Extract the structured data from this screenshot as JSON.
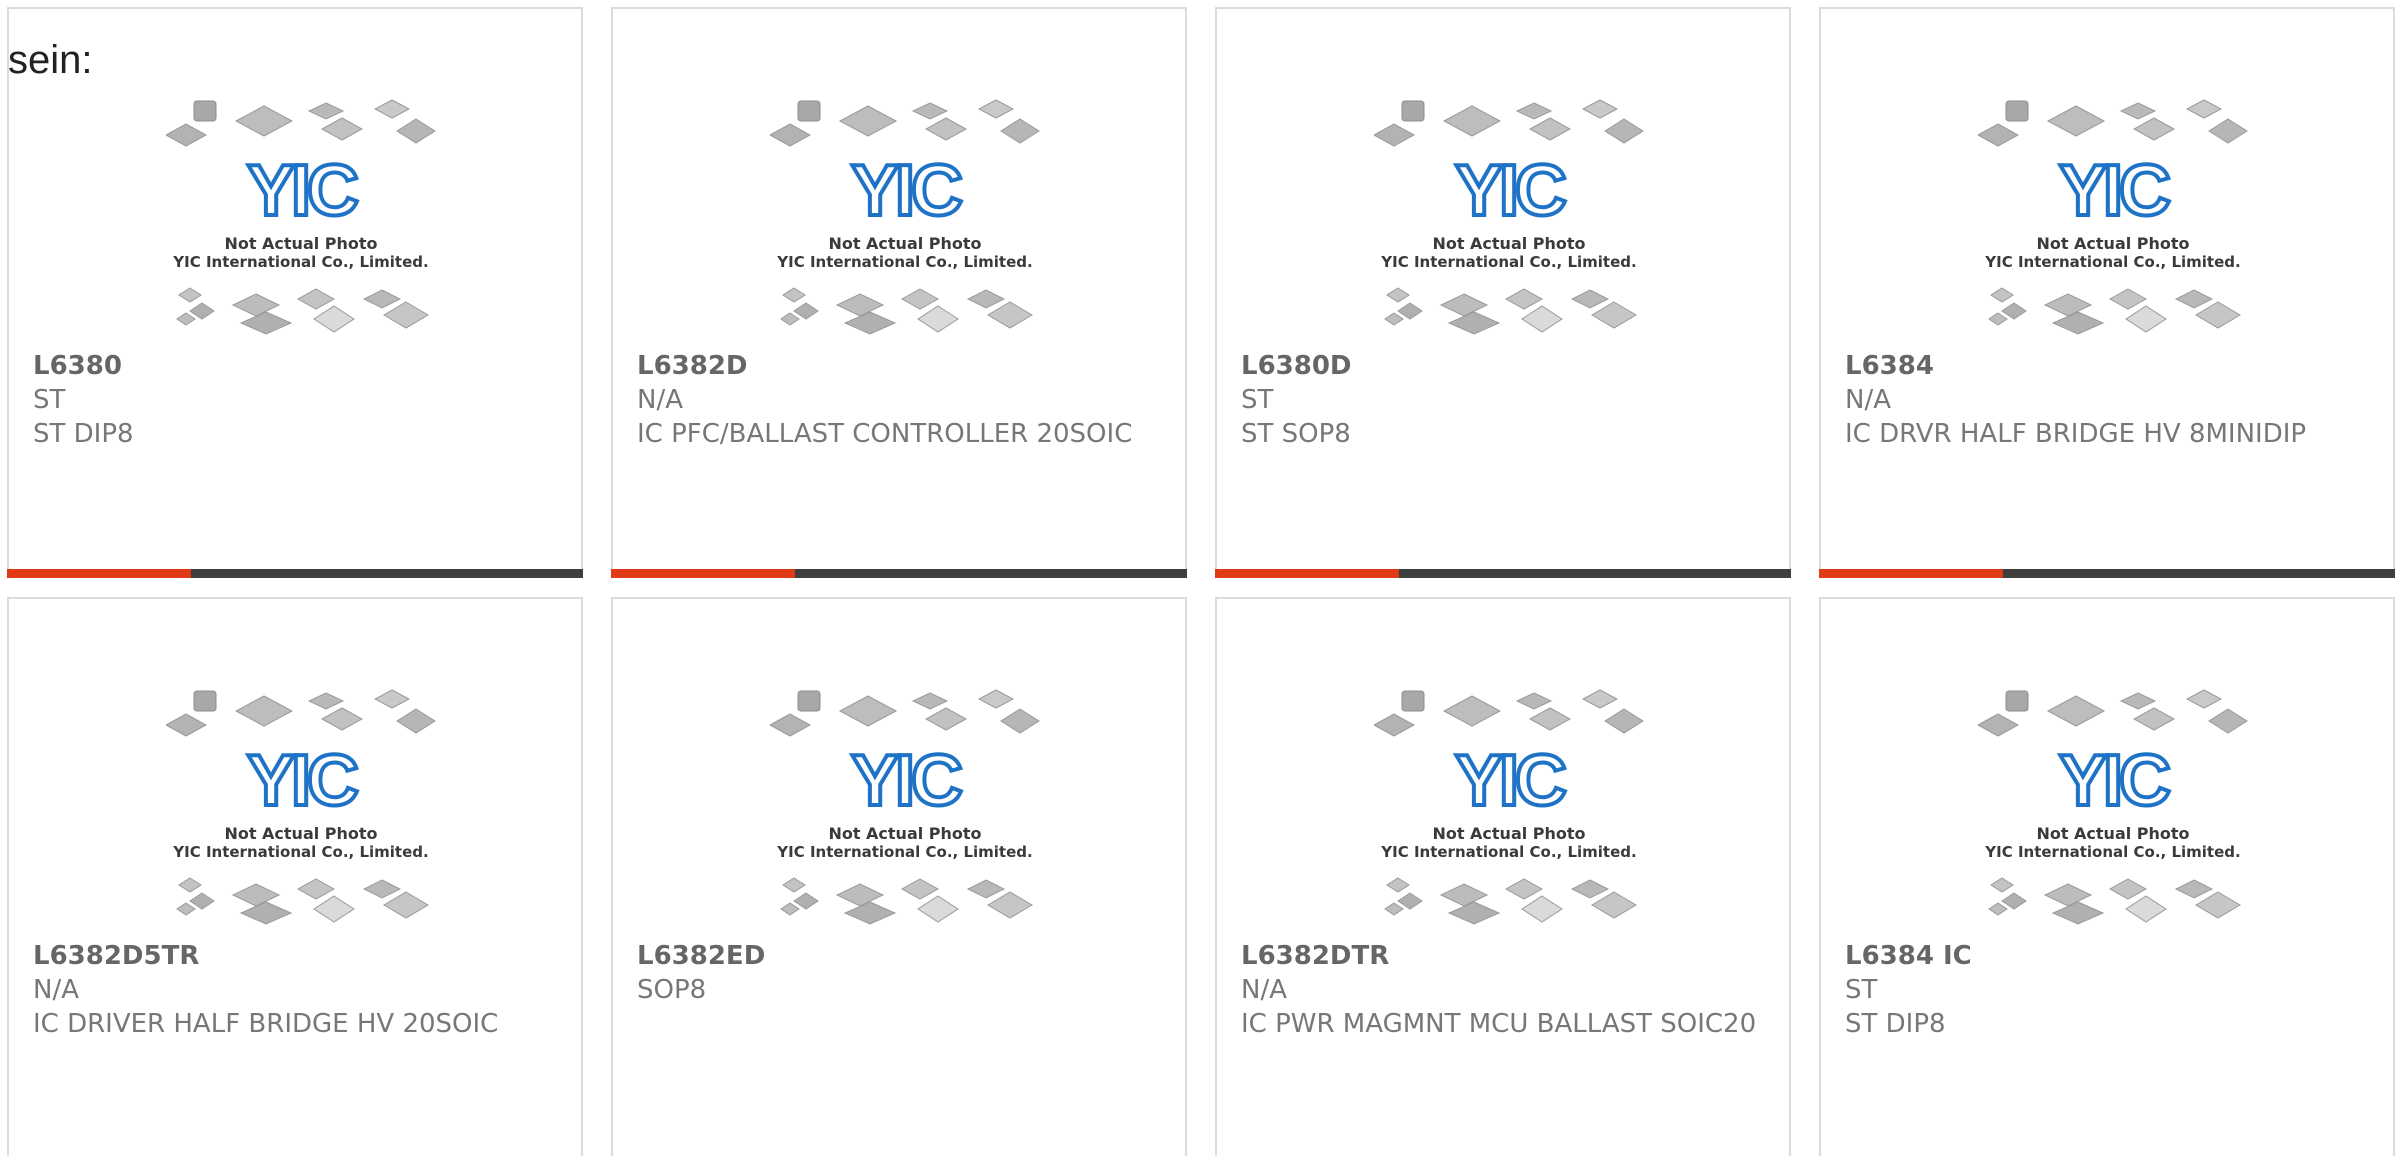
{
  "intro_text": "sein:",
  "photo": {
    "line1": "Not Actual Photo",
    "line2": "YIC International Co., Limited.",
    "logo_text": "YIC"
  },
  "colors": {
    "accent": "#e03a16",
    "bar_dark": "#3f3f3f",
    "logo_blue": "#1f73c6",
    "text_gray": "#777777"
  },
  "products": [
    {
      "part": "L6380",
      "manufacturer": "ST",
      "description": "ST DIP8"
    },
    {
      "part": "L6382D",
      "manufacturer": "N/A",
      "description": "IC PFC/BALLAST CONTROLLER 20SOIC"
    },
    {
      "part": "L6380D",
      "manufacturer": "ST",
      "description": "ST SOP8"
    },
    {
      "part": "L6384",
      "manufacturer": "N/A",
      "description": "IC DRVR HALF BRIDGE HV 8MINIDIP"
    },
    {
      "part": "L6382D5TR",
      "manufacturer": "N/A",
      "description": "IC DRIVER HALF BRIDGE HV 20SOIC"
    },
    {
      "part": "L6382ED",
      "manufacturer": "SOP8",
      "description": ""
    },
    {
      "part": "L6382DTR",
      "manufacturer": "N/A",
      "description": "IC PWR MAGMNT MCU BALLAST SOIC20"
    },
    {
      "part": "L6384 IC",
      "manufacturer": "ST",
      "description": "ST DIP8"
    }
  ]
}
